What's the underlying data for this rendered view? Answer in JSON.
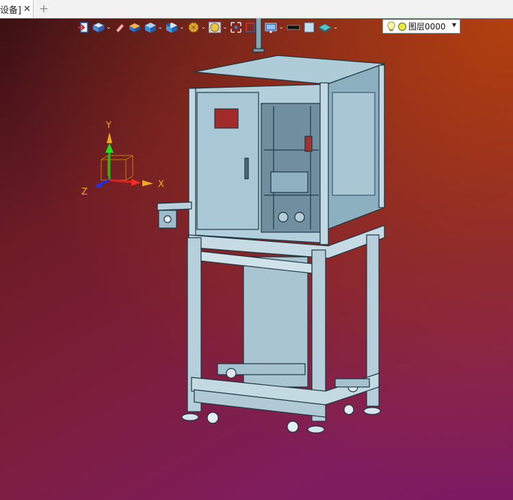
{
  "tab": {
    "title": "设备]",
    "close_glyph": "✕",
    "add_glyph": "+"
  },
  "toolbar": {
    "buttons": [
      "exit-view-icon",
      "view-orientation-icon",
      "eraser-icon",
      "shaded-box-icon",
      "solid-box-icon",
      "display-mode-icon",
      "section-view-icon",
      "render-sphere-icon",
      "zoom-fit-icon",
      "rotate-icon",
      "dimension-icon",
      "monitor-icon",
      "black-color-swatch-icon",
      "light-blue-color-swatch-icon",
      "layer-plane-icon"
    ],
    "layer": {
      "name": "图层0000"
    }
  },
  "triad": {
    "y_label": "Y",
    "z_label": "Z",
    "x_label": "X"
  },
  "colors": {
    "tab_bg": "#f2f2f2",
    "viewport_top": "#3a1014",
    "viewport_glow": "#b2400e",
    "viewport_bottom": "#801d5c",
    "model": "#9fc0cf"
  }
}
